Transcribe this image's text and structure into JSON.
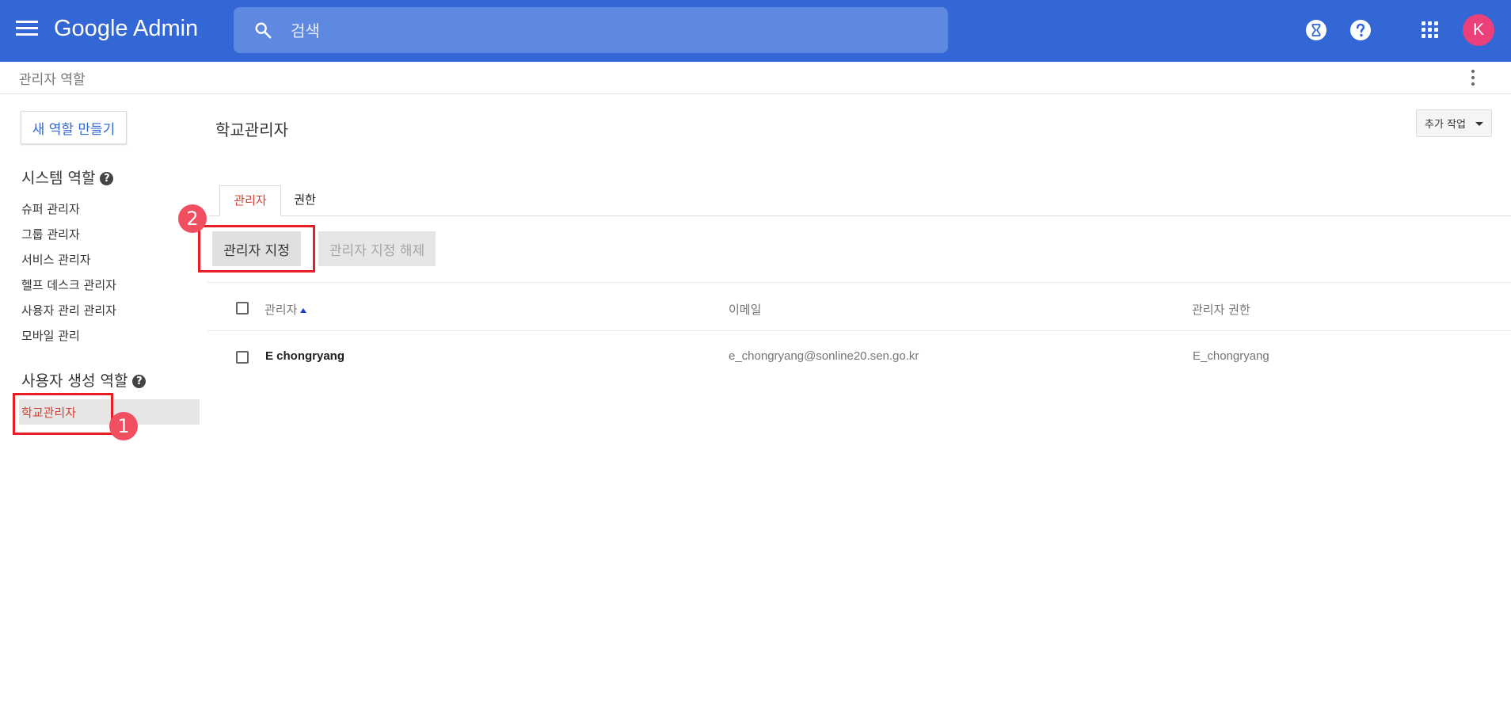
{
  "header": {
    "logo": "Google Admin",
    "search_placeholder": "검색",
    "avatar_initial": "K",
    "icons": [
      "menu-icon",
      "search-icon",
      "hourglass-icon",
      "help-icon",
      "apps-icon"
    ]
  },
  "breadcrumb": "관리자 역할",
  "sidebar": {
    "new_role_label": "새 역할 만들기",
    "system_roles_heading": "시스템 역할",
    "system_roles": [
      {
        "label": "슈퍼 관리자"
      },
      {
        "label": "그룹 관리자"
      },
      {
        "label": "서비스 관리자"
      },
      {
        "label": "헬프 데스크 관리자"
      },
      {
        "label": "사용자 관리 관리자"
      },
      {
        "label": "모바일 관리"
      }
    ],
    "custom_roles_heading": "사용자 생성 역할",
    "custom_roles": [
      {
        "label": "학교관리자"
      }
    ]
  },
  "main": {
    "title": "학교관리자",
    "more_actions": "추가 작업",
    "tabs": [
      {
        "label": "관리자"
      },
      {
        "label": "권한"
      }
    ],
    "assign_label": "관리자 지정",
    "unassign_label": "관리자 지정 해제",
    "table": {
      "columns": [
        "관리자",
        "이메일",
        "관리자 권한"
      ],
      "rows": [
        {
          "name": "E chongryang",
          "email": "e_chongryang@sonline20.sen.go.kr",
          "role": "E_chongryang"
        }
      ]
    }
  },
  "annotations": {
    "step1": "1",
    "step2": "2",
    "color": "#e81d23"
  },
  "colors": {
    "topbar": "#3367d6",
    "accent_red": "#d23f31",
    "link_blue": "#3367d6",
    "avatar": "#ec407a"
  }
}
